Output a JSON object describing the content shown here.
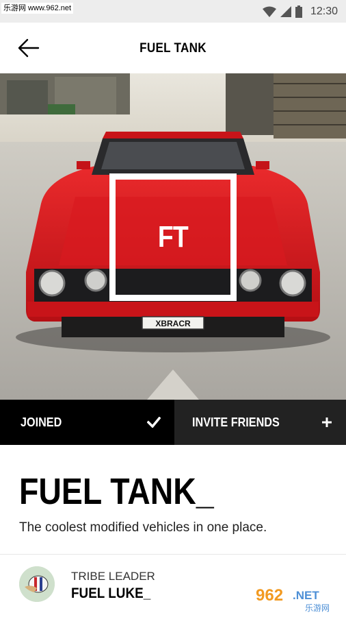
{
  "status_bar": {
    "watermark": "乐游网 www.962.net",
    "time": "12:30",
    "icons": [
      "wifi-icon",
      "signal-icon",
      "battery-icon"
    ]
  },
  "app_bar": {
    "title": "FUEL TANK",
    "back_icon": "arrow-left-icon"
  },
  "hero": {
    "logo_text": "FT",
    "plate_text": "XBRACR"
  },
  "actions": {
    "joined_label": "JOINED",
    "joined_icon": "checkmark-icon",
    "invite_label": "INVITE FRIENDS",
    "invite_icon": "plus-icon"
  },
  "tribe": {
    "name": "FUEL TANK_",
    "description": "The coolest modified vehicles in one place."
  },
  "leader": {
    "role": "TRIBE LEADER",
    "name": "FUEL LUKE_"
  },
  "watermark_bottom": {
    "brand": "962",
    "domain": ".NET",
    "chinese": "乐游网"
  },
  "colors": {
    "car_red": "#d8161c",
    "action_joined_bg": "#000000",
    "action_invite_bg": "#222222",
    "status_bg": "#ededed"
  }
}
